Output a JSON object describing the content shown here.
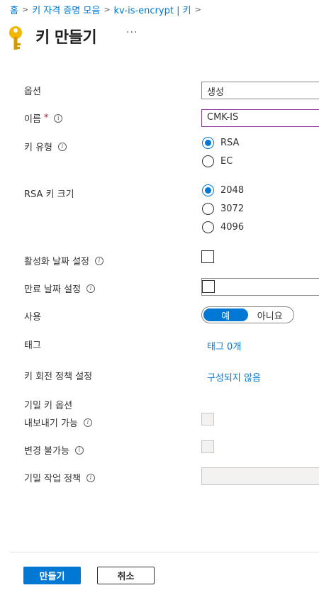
{
  "breadcrumb": {
    "items": [
      "홈",
      "키 자격 증명 모음",
      "kv-is-encrypt | 키"
    ],
    "separator": ">"
  },
  "page": {
    "title": "키 만들기",
    "more": "···"
  },
  "form": {
    "options": {
      "label": "옵션",
      "value": "생성"
    },
    "name": {
      "label": "이름",
      "required": "*",
      "value": "CMK-IS"
    },
    "key_type": {
      "label": "키 유형",
      "options": [
        "RSA",
        "EC"
      ],
      "selected": "RSA"
    },
    "rsa_size": {
      "label": "RSA 키 크기",
      "options": [
        "2048",
        "3072",
        "4096"
      ],
      "selected": "2048"
    },
    "activation": {
      "label": "활성화 날짜 설정"
    },
    "expiration": {
      "label": "만료 날짜 설정"
    },
    "enabled": {
      "label": "사용",
      "yes": "예",
      "no": "아니요",
      "selected": "예"
    },
    "tags": {
      "label": "태그",
      "value": "태그 0개"
    },
    "rotation": {
      "label": "키 회전 정책 설정",
      "value": "구성되지 않음"
    },
    "confidential": {
      "heading": "기밀 키 옵션",
      "exportable": "내보내기 가능",
      "immutable": "변경 불가능",
      "policy": "기밀 작업 정책"
    }
  },
  "actions": {
    "create": "만들기",
    "cancel": "취소"
  },
  "colors": {
    "accent": "#0078d4",
    "focus_border": "#8d3f9b",
    "required": "#a4262c",
    "key_gold": "#f2b600"
  },
  "icons": {
    "key": "key-icon",
    "info": "info-icon",
    "chevron": "chevron-right-icon"
  }
}
